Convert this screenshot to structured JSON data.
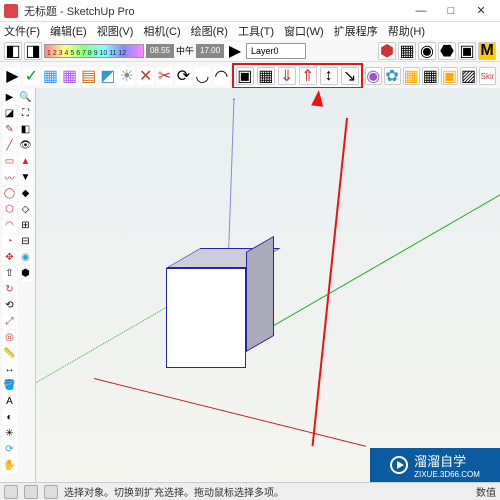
{
  "window": {
    "title": "无标题 - SketchUp Pro",
    "controls": {
      "minimize": "—",
      "maximize": "□",
      "close": "✕"
    }
  },
  "menu": {
    "file": "文件(F)",
    "edit": "编辑(E)",
    "view": "视图(V)",
    "camera": "相机(C)",
    "draw": "绘图(R)",
    "tools": "工具(T)",
    "window": "窗口(W)",
    "extensions": "扩展程序",
    "help": "帮助(H)"
  },
  "top_toolbar": {
    "gradient_numbers": "1 2 3 4 5 6 7 8 9 10 11 12",
    "time1": "08.55",
    "mid": "中午",
    "time2": "17.00",
    "layer": "Layer0"
  },
  "icons": {
    "select": "▶",
    "paint": "🪣",
    "eraser": "⌫",
    "pencil": "✎",
    "rect": "▭",
    "circle": "◯",
    "arc": "◠",
    "push": "⇧",
    "move": "✥",
    "rotate": "↻",
    "scale": "⤢",
    "tape": "📏",
    "text": "A",
    "orbit": "⟳",
    "pan": "✋",
    "zoom": "🔍",
    "box": "▦",
    "sphere": "●",
    "cone": "△",
    "torus": "◎",
    "undo": "↶",
    "redo": "↷",
    "save": "💾",
    "open": "📂",
    "new": "📄",
    "print": "🖨",
    "cut": "✂",
    "copy": "⧉",
    "warehouse": "M",
    "gear": "⚙",
    "lock": "✓"
  },
  "highlight_tools": [
    "▣",
    "▦",
    "⇓",
    "⇑",
    "↕",
    "↘"
  ],
  "status": {
    "hint": "选择对象。切换到扩充选择。拖动鼠标选择多项。",
    "value_label": "数值"
  },
  "watermark": {
    "brand": "溜溜自学",
    "url": "ZIXUE.3D66.COM"
  },
  "colors": {
    "highlight_border": "#e11",
    "axis_red": "#c22",
    "axis_green": "#2a2",
    "axis_blue": "#22d",
    "watermark_bg": "#0b5ba0"
  }
}
